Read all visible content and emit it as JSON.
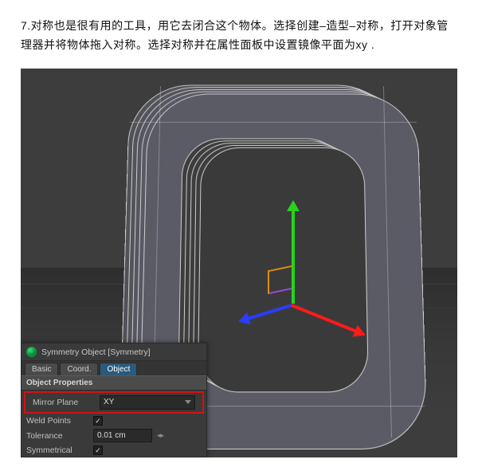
{
  "instruction": {
    "text": "7.对称也是很有用的工具，用它去闭合这个物体。选择创建–造型–对称，打开对象管理器并将物体拖入对称。选择对称并在属性面板中设置镜像平面为xy ."
  },
  "panel": {
    "title": "Symmetry Object [Symmetry]",
    "tabs": {
      "basic": "Basic",
      "coord": "Coord.",
      "object": "Object"
    },
    "section": "Object Properties",
    "mirror_plane_label": "Mirror Plane",
    "mirror_plane_value": "XY",
    "weld_points_label": "Weld Points",
    "weld_points_checked": true,
    "tolerance_label": "Tolerance",
    "tolerance_value": "0.01 cm",
    "symmetrical_label": "Symmetrical",
    "symmetrical_checked": true
  },
  "chart_data": null
}
